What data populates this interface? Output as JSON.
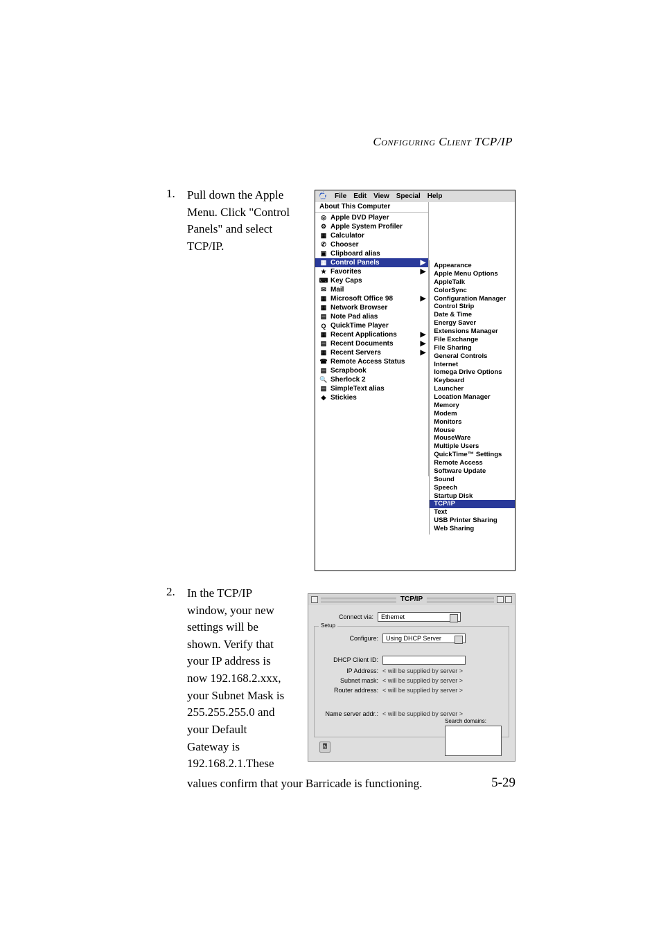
{
  "header": "Configuring Client TCP/IP",
  "step1": {
    "num": "1.",
    "text": "Pull down the Apple Menu. Click \"Control Panels\" and select TCP/IP."
  },
  "step2": {
    "num": "2.",
    "text": "In the TCP/IP window, your new settings will be shown. Verify that your IP address is now 192.168.2.xxx, your Subnet Mask is 255.255.255.0 and your Default Gateway is 192.168.2.1.These",
    "confirm": "values confirm that your Barricade is functioning."
  },
  "pageNumber": "5-29",
  "mac_menu": {
    "menubar": [
      "File",
      "Edit",
      "View",
      "Special",
      "Help"
    ],
    "about": "About This Computer",
    "items": [
      {
        "label": "Apple DVD Player",
        "icon": "◎"
      },
      {
        "label": "Apple System Profiler",
        "icon": "⚙"
      },
      {
        "label": "Calculator",
        "icon": "▦"
      },
      {
        "label": "Chooser",
        "icon": "✆"
      },
      {
        "label": "Clipboard alias",
        "icon": "▣"
      },
      {
        "label": "Control Panels",
        "icon": "▦",
        "sel": true,
        "arrow": true
      },
      {
        "label": "Favorites",
        "icon": "★",
        "arrow": true
      },
      {
        "label": "Key Caps",
        "icon": "⌨"
      },
      {
        "label": "Mail",
        "icon": "✉"
      },
      {
        "label": "Microsoft Office 98",
        "icon": "▦",
        "arrow": true
      },
      {
        "label": "Network Browser",
        "icon": "▦"
      },
      {
        "label": "Note Pad alias",
        "icon": "▤"
      },
      {
        "label": "QuickTime Player",
        "icon": "Q"
      },
      {
        "label": "Recent Applications",
        "icon": "▦",
        "arrow": true
      },
      {
        "label": "Recent Documents",
        "icon": "▤",
        "arrow": true
      },
      {
        "label": "Recent Servers",
        "icon": "▦",
        "arrow": true
      },
      {
        "label": "Remote Access Status",
        "icon": "☎"
      },
      {
        "label": "Scrapbook",
        "icon": "▤"
      },
      {
        "label": "Sherlock 2",
        "icon": "🔍"
      },
      {
        "label": "SimpleText alias",
        "icon": "▤"
      },
      {
        "label": "Stickies",
        "icon": "◆"
      }
    ],
    "submenu": [
      "Appearance",
      "Apple Menu Options",
      "AppleTalk",
      "ColorSync",
      "Configuration Manager",
      "Control Strip",
      "Date & Time",
      "Energy Saver",
      "Extensions Manager",
      "File Exchange",
      "File Sharing",
      "General Controls",
      "Internet",
      "Iomega Drive Options",
      "Keyboard",
      "Launcher",
      "Location Manager",
      "Memory",
      "Modem",
      "Monitors",
      "Mouse",
      "MouseWare",
      "Multiple Users",
      "QuickTime™ Settings",
      "Remote Access",
      "Software Update",
      "Sound",
      "Speech",
      "Startup Disk",
      "TCP/IP",
      "Text",
      "USB Printer Sharing",
      "Web Sharing"
    ],
    "submenu_selected": "TCP/IP"
  },
  "tcpip": {
    "title": "TCP/IP",
    "connect_label": "Connect via:",
    "connect_value": "Ethernet",
    "setup_label": "Setup",
    "configure_label": "Configure:",
    "configure_value": "Using DHCP Server",
    "client_label": "DHCP Client ID:",
    "ip_label": "IP Address:",
    "ip_value": "< will be supplied by server >",
    "mask_label": "Subnet mask:",
    "mask_value": "< will be supplied by server >",
    "router_label": "Router address:",
    "router_value": "< will be supplied by server >",
    "ns_label": "Name server addr.:",
    "ns_value": "< will be supplied by server >",
    "search_label": "Search domains:"
  }
}
